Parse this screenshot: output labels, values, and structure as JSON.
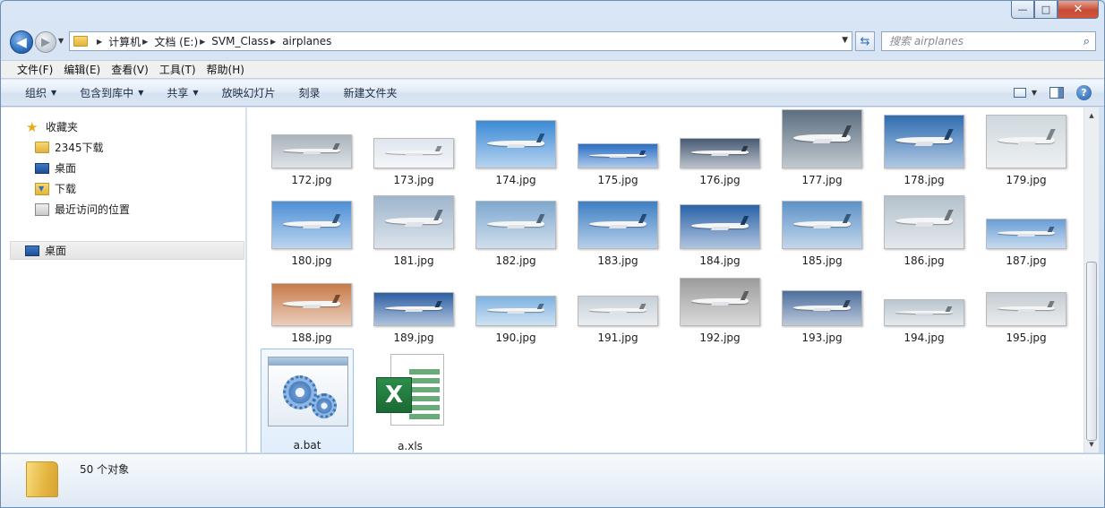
{
  "window": {
    "minimize": "—",
    "maximize": "□",
    "close": "✕"
  },
  "breadcrumb": [
    "计算机",
    "文档 (E:)",
    "SVM_Class",
    "airplanes"
  ],
  "search": {
    "placeholder": "搜索 airplanes"
  },
  "menubar": [
    "文件(F)",
    "编辑(E)",
    "查看(V)",
    "工具(T)",
    "帮助(H)"
  ],
  "commands": [
    {
      "label": "组织",
      "has_dropdown": true
    },
    {
      "label": "包含到库中",
      "has_dropdown": true
    },
    {
      "label": "共享",
      "has_dropdown": true
    },
    {
      "label": "放映幻灯片",
      "has_dropdown": false
    },
    {
      "label": "刻录",
      "has_dropdown": false
    },
    {
      "label": "新建文件夹",
      "has_dropdown": false
    }
  ],
  "navpane": {
    "favorites_label": "收藏夹",
    "favorites": [
      "2345下载",
      "桌面",
      "下载",
      "最近访问的位置"
    ],
    "desktop_label": "桌面"
  },
  "files": [
    {
      "name": "172.jpg",
      "sky": "#a9b3bb"
    },
    {
      "name": "173.jpg",
      "sky": "#dfe6ee"
    },
    {
      "name": "174.jpg",
      "sky": "#3b8ad6"
    },
    {
      "name": "175.jpg",
      "sky": "#2a6fc4"
    },
    {
      "name": "176.jpg",
      "sky": "#475a74"
    },
    {
      "name": "177.jpg",
      "sky": "#5b6e80"
    },
    {
      "name": "178.jpg",
      "sky": "#2f6db2"
    },
    {
      "name": "179.jpg",
      "sky": "#cfd8de"
    },
    {
      "name": "180.jpg",
      "sky": "#4d8fd6"
    },
    {
      "name": "181.jpg",
      "sky": "#9fb6cc"
    },
    {
      "name": "182.jpg",
      "sky": "#7fa8cf"
    },
    {
      "name": "183.jpg",
      "sky": "#3e7fc4"
    },
    {
      "name": "184.jpg",
      "sky": "#2a62a8"
    },
    {
      "name": "185.jpg",
      "sky": "#5d92c8"
    },
    {
      "name": "186.jpg",
      "sky": "#b4c1cc"
    },
    {
      "name": "187.jpg",
      "sky": "#6a9ed6"
    },
    {
      "name": "188.jpg",
      "sky": "#c77b4a"
    },
    {
      "name": "189.jpg",
      "sky": "#2d5fa3"
    },
    {
      "name": "190.jpg",
      "sky": "#7eb2df"
    },
    {
      "name": "191.jpg",
      "sky": "#c6d0d8"
    },
    {
      "name": "192.jpg",
      "sky": "#9c9c9c"
    },
    {
      "name": "193.jpg",
      "sky": "#4d6f9d"
    },
    {
      "name": "194.jpg",
      "sky": "#b9c6cf"
    },
    {
      "name": "195.jpg",
      "sky": "#c5ccd2"
    }
  ],
  "other_files": [
    {
      "name": "a.bat",
      "type": "batch"
    },
    {
      "name": "a.xls",
      "type": "excel"
    }
  ],
  "status": {
    "count_text": "50 个对象"
  }
}
